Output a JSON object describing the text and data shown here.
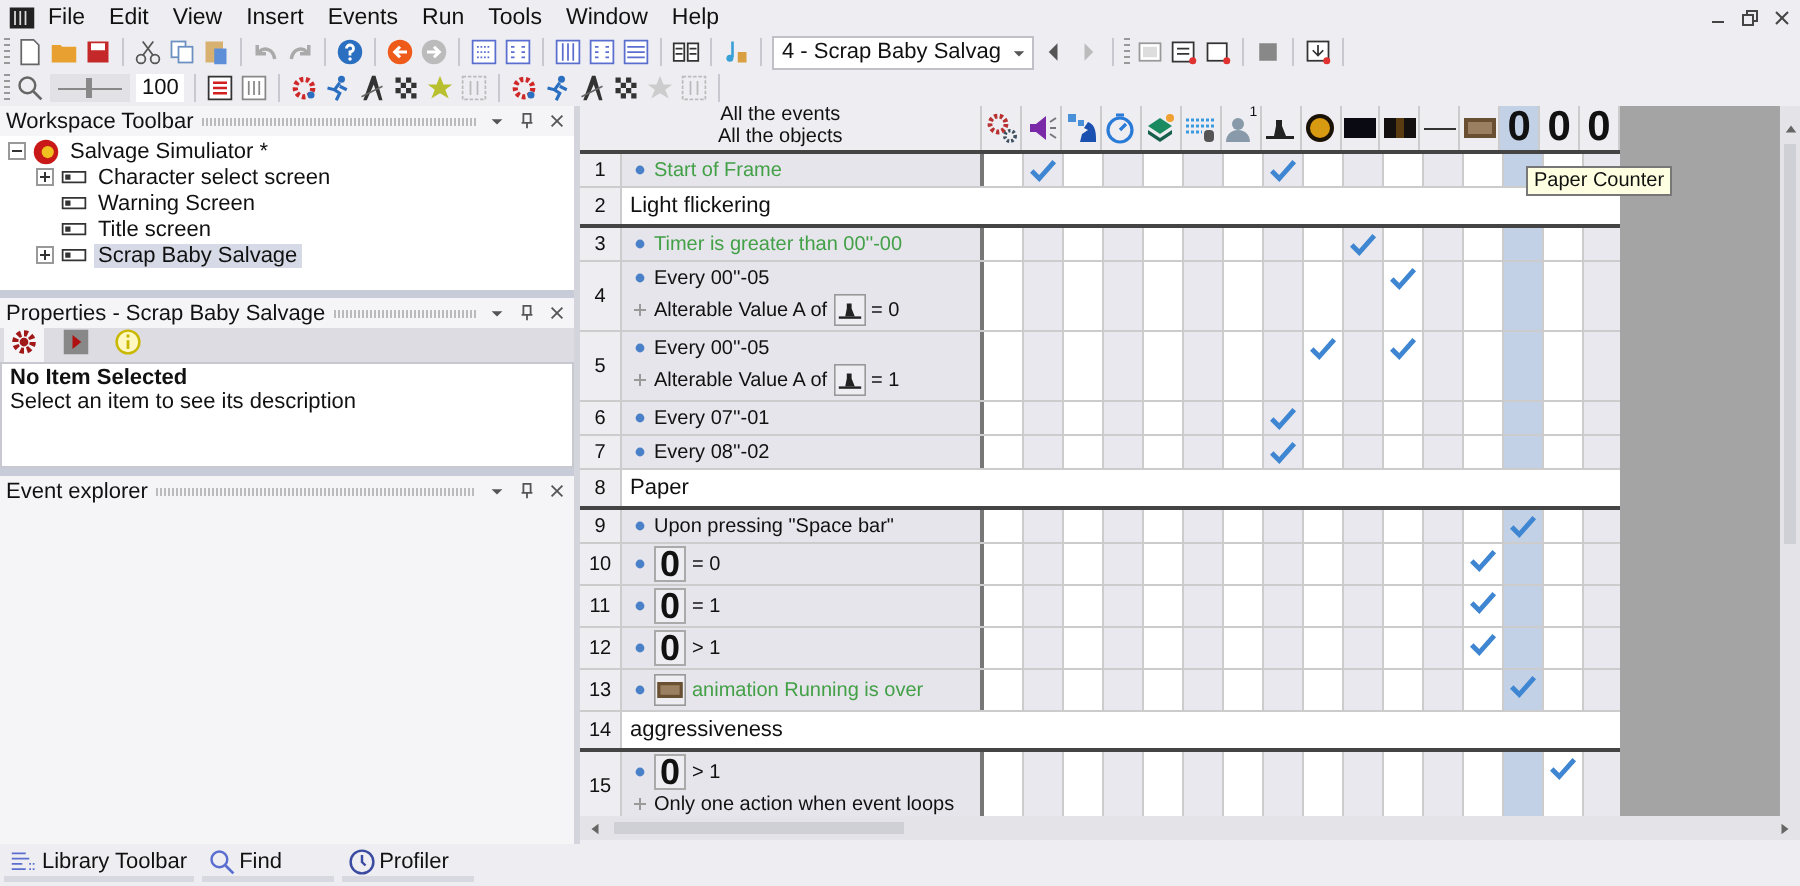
{
  "menu": [
    "File",
    "Edit",
    "View",
    "Insert",
    "Events",
    "Run",
    "Tools",
    "Window",
    "Help"
  ],
  "toolbar": {
    "frame_select": "4 - Scrap Baby Salvag",
    "zoom_slider": {
      "level": 0.5
    },
    "zoom": "100"
  },
  "workspace": {
    "title": "Workspace Toolbar",
    "tree": [
      {
        "label": "Salvage Simuliator *",
        "expanded": true,
        "selected": false,
        "children": [
          {
            "label": "Character select screen",
            "expanded": false,
            "selected": false
          },
          {
            "label": "Warning Screen",
            "selected": false
          },
          {
            "label": "Title screen",
            "selected": false
          },
          {
            "label": "Scrap Baby Salvage",
            "expanded": false,
            "selected": true
          }
        ]
      }
    ]
  },
  "properties": {
    "title": "Properties - Scrap Baby Salvage",
    "tabs": [
      {
        "kind": "gear",
        "selected": true
      },
      {
        "kind": "play",
        "selected": false
      },
      {
        "kind": "info",
        "selected": false
      }
    ],
    "heading": "No Item Selected",
    "description": "Select an item to see its description"
  },
  "event_explorer": {
    "title": "Event explorer"
  },
  "bottom_tabs": [
    {
      "kind": "library",
      "label": "Library Toolbar"
    },
    {
      "kind": "find",
      "label": "Find"
    },
    {
      "kind": "profiler",
      "label": "Profiler"
    }
  ],
  "editor": {
    "header": [
      "All the events",
      "All the objects"
    ],
    "tooltip": "Paper Counter",
    "columns": [
      {
        "kind": "gears",
        "selected": false
      },
      {
        "kind": "speaker",
        "selected": false
      },
      {
        "kind": "pieces",
        "selected": false
      },
      {
        "kind": "stopwatch",
        "selected": false
      },
      {
        "kind": "stack",
        "selected": false
      },
      {
        "kind": "keyboard",
        "selected": false
      },
      {
        "kind": "person",
        "badge": "1",
        "selected": false
      },
      {
        "kind": "figure",
        "selected": false
      },
      {
        "kind": "orb",
        "selected": false
      },
      {
        "kind": "bar",
        "selected": false
      },
      {
        "kind": "glowbar",
        "selected": false
      },
      {
        "kind": "line",
        "selected": false
      },
      {
        "kind": "panel",
        "selected": false
      },
      {
        "kind": "counter",
        "text": "0",
        "selected": true
      },
      {
        "kind": "counter",
        "text": "0",
        "selected": false
      },
      {
        "kind": "counter",
        "text": "0",
        "selected": false
      }
    ],
    "rows": [
      {
        "number": "1",
        "kind": "event",
        "conditions": [
          {
            "kind": "trigger",
            "text": "Start of Frame"
          }
        ],
        "checked": [
          false,
          true,
          false,
          false,
          false,
          false,
          false,
          true,
          false,
          false,
          false,
          false,
          false
        ]
      },
      {
        "number": "2",
        "kind": "comment",
        "text": "Light flickering"
      },
      {
        "number": "3",
        "kind": "event",
        "conditions": [
          {
            "kind": "trigger",
            "text": "Timer is greater than 00''-00"
          }
        ],
        "checked": [
          false,
          false,
          false,
          false,
          false,
          false,
          false,
          false,
          false,
          true,
          false,
          false,
          false,
          false,
          false,
          false
        ]
      },
      {
        "number": "4",
        "kind": "event",
        "conditions": [
          {
            "kind": "normal",
            "text": "Every 00''-05"
          },
          {
            "kind": "normal",
            "text": "Alterable Value A of",
            "object": {
              "kind": "figure"
            },
            "after": "= 0"
          }
        ],
        "checked": [
          false,
          false,
          false,
          false,
          false,
          false,
          false,
          false,
          false,
          false,
          true,
          false,
          false,
          false,
          false,
          false
        ]
      },
      {
        "number": "5",
        "kind": "event",
        "conditions": [
          {
            "kind": "normal",
            "text": "Every 00''-05"
          },
          {
            "kind": "normal",
            "text": "Alterable Value A of",
            "object": {
              "kind": "figure"
            },
            "after": "= 1"
          }
        ],
        "checked": [
          false,
          false,
          false,
          false,
          false,
          false,
          false,
          false,
          true,
          false,
          true,
          false,
          false,
          false,
          false,
          false
        ]
      },
      {
        "number": "6",
        "kind": "event",
        "conditions": [
          {
            "kind": "normal",
            "text": "Every 07''-01"
          }
        ],
        "checked": [
          false,
          false,
          false,
          false,
          false,
          false,
          false,
          true,
          false,
          false,
          false,
          false,
          false,
          false,
          false,
          false
        ]
      },
      {
        "number": "7",
        "kind": "event",
        "conditions": [
          {
            "kind": "normal",
            "text": "Every 08''-02"
          }
        ],
        "checked": [
          false,
          false,
          false,
          false,
          false,
          false,
          false,
          true,
          false,
          false,
          false,
          false,
          false,
          false,
          false,
          false
        ]
      },
      {
        "number": "8",
        "kind": "comment",
        "text": "Paper"
      },
      {
        "number": "9",
        "kind": "event",
        "conditions": [
          {
            "kind": "normal",
            "text": "Upon pressing \"Space bar\""
          }
        ],
        "checked": [
          false,
          false,
          false,
          false,
          false,
          false,
          false,
          false,
          false,
          false,
          false,
          false,
          false,
          true,
          false,
          false
        ]
      },
      {
        "number": "10",
        "kind": "event",
        "conditions": [
          {
            "kind": "normal",
            "object": {
              "kind": "counter",
              "text": "0"
            },
            "after": "= 0"
          }
        ],
        "checked": [
          false,
          false,
          false,
          false,
          false,
          false,
          false,
          false,
          false,
          false,
          false,
          false,
          true,
          false,
          false,
          false
        ]
      },
      {
        "number": "11",
        "kind": "event",
        "conditions": [
          {
            "kind": "normal",
            "object": {
              "kind": "counter",
              "text": "0"
            },
            "after": "= 1"
          }
        ],
        "checked": [
          false,
          false,
          false,
          false,
          false,
          false,
          false,
          false,
          false,
          false,
          false,
          false,
          true,
          false,
          false,
          false
        ]
      },
      {
        "number": "12",
        "kind": "event",
        "conditions": [
          {
            "kind": "normal",
            "object": {
              "kind": "counter",
              "text": "0"
            },
            "after": "> 1"
          }
        ],
        "checked": [
          false,
          false,
          false,
          false,
          false,
          false,
          false,
          false,
          false,
          false,
          false,
          false,
          true,
          false,
          false,
          false
        ]
      },
      {
        "number": "13",
        "kind": "event",
        "conditions": [
          {
            "kind": "trigger",
            "object": {
              "kind": "panel"
            },
            "after": "animation Running is over"
          }
        ],
        "checked": [
          false,
          false,
          false,
          false,
          false,
          false,
          false,
          false,
          false,
          false,
          false,
          false,
          false,
          true,
          false,
          false
        ]
      },
      {
        "number": "14",
        "kind": "comment",
        "text": "aggressiveness"
      },
      {
        "number": "15",
        "kind": "event",
        "conditions": [
          {
            "kind": "normal",
            "object": {
              "kind": "counter",
              "text": "0"
            },
            "after": "> 1"
          },
          {
            "kind": "normal",
            "text": "Only one action when event loops"
          }
        ],
        "checked": [
          false,
          false,
          false,
          false,
          false,
          false,
          false,
          false,
          false,
          false,
          false,
          false,
          false,
          false,
          true,
          false
        ]
      }
    ]
  }
}
